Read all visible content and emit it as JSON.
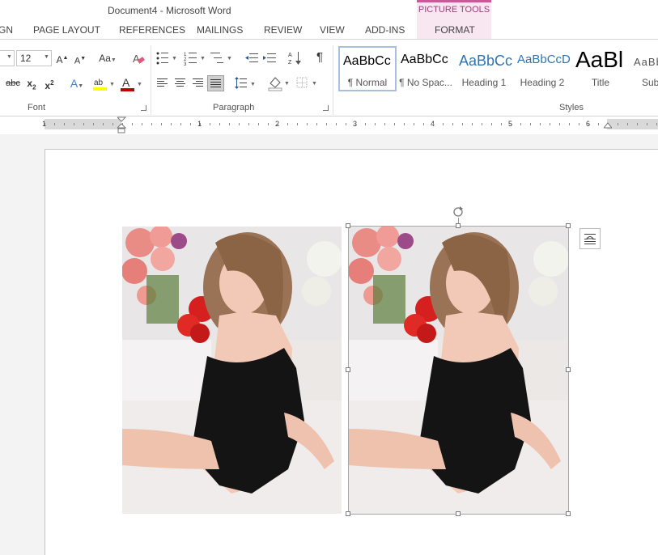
{
  "window": {
    "title": "Document4 - Microsoft Word"
  },
  "contextual": {
    "label": "PICTURE TOOLS"
  },
  "tabs": [
    {
      "label": "GN"
    },
    {
      "label": "PAGE LAYOUT"
    },
    {
      "label": "REFERENCES"
    },
    {
      "label": "MAILINGS"
    },
    {
      "label": "REVIEW"
    },
    {
      "label": "VIEW"
    },
    {
      "label": "ADD-INS"
    },
    {
      "label": "FORMAT"
    }
  ],
  "font": {
    "size": "12",
    "group_label": "Font"
  },
  "paragraph": {
    "group_label": "Paragraph"
  },
  "styles": {
    "group_label": "Styles",
    "items": [
      {
        "preview": "AaBbCc",
        "name": "¶ Normal"
      },
      {
        "preview": "AaBbCc",
        "name": "¶ No Spac..."
      },
      {
        "preview": "AaBbCc",
        "name": "Heading 1"
      },
      {
        "preview": "AaBbCcD",
        "name": "Heading 2"
      },
      {
        "preview": "AaBl",
        "name": "Title"
      },
      {
        "preview": "AaBb",
        "name": "Sub"
      }
    ]
  },
  "ruler": {
    "numbers": [
      "1",
      "1",
      "2",
      "3",
      "4",
      "5",
      "6"
    ]
  },
  "colors": {
    "accent": "#2b579a",
    "contextual": "#c95a9a",
    "font_color": "#c00000",
    "highlight": "#ffff00"
  },
  "icons": [
    "font-size-up-icon",
    "font-size-down-icon",
    "change-case-icon",
    "clear-formatting-icon",
    "bullets-icon",
    "numbering-icon",
    "multilevel-list-icon",
    "decrease-indent-icon",
    "increase-indent-icon",
    "sort-icon",
    "show-marks-icon",
    "strikethrough-icon",
    "subscript-icon",
    "superscript-icon",
    "text-effects-icon",
    "highlight-icon",
    "font-color-icon",
    "align-left-icon",
    "center-icon",
    "align-right-icon",
    "justify-icon",
    "line-spacing-icon",
    "shading-icon",
    "borders-icon",
    "rotate-handle-icon",
    "layout-options-icon"
  ]
}
